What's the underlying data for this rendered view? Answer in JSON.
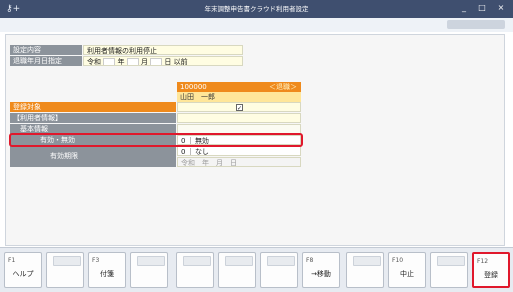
{
  "window": {
    "title": "年末調整申告書クラウド利用者設定",
    "icon": "key-plus-icon",
    "controls": [
      "_",
      "□",
      "×"
    ]
  },
  "settings": {
    "content_label": "設定内容",
    "content_value": "利用者情報の利用停止",
    "retire_label": "退職年月日指定",
    "era": "令和",
    "year_unit": "年",
    "month_unit": "月",
    "day_after": "日 以前"
  },
  "employee": {
    "code": "100000",
    "status": "＜退職＞",
    "name": "山田　一郎"
  },
  "rows": {
    "registration_target_label": "登録対象",
    "registration_checked": "✓",
    "user_info_label": "【利用者情報】",
    "basic_info_label": "基本情報",
    "valid_invalid_label": "有効・無効",
    "valid_invalid_code": "0",
    "valid_invalid_value": "無効",
    "validity_period_label": "有効期限",
    "validity_code": "0",
    "validity_value": "なし",
    "validity_date_placeholder": "令和　年　月　日"
  },
  "function_keys": [
    {
      "key": "F1",
      "label": "ヘルプ"
    },
    {
      "key": "",
      "label": ""
    },
    {
      "key": "F3",
      "label": "付箋"
    },
    {
      "key": "",
      "label": ""
    },
    {
      "key": "",
      "label": ""
    },
    {
      "key": "",
      "label": ""
    },
    {
      "key": "",
      "label": ""
    },
    {
      "key": "F8",
      "label": "→移動"
    },
    {
      "key": "",
      "label": ""
    },
    {
      "key": "F10",
      "label": "中止"
    },
    {
      "key": "",
      "label": ""
    },
    {
      "key": "F12",
      "label": "登録"
    }
  ],
  "colors": {
    "accent_orange": "#ef8a1c",
    "highlight_red": "#e0182c",
    "titlebar": "#3f4f6f"
  }
}
